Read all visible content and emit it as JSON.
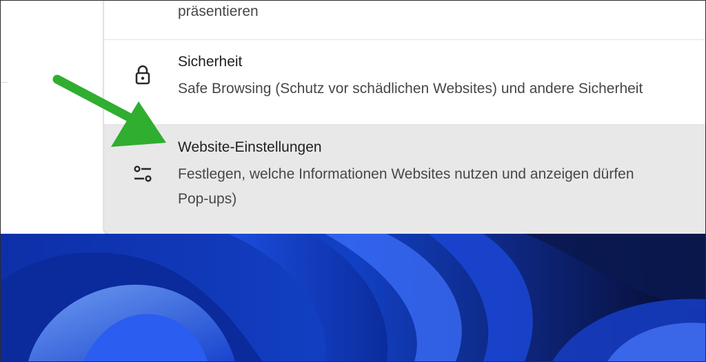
{
  "settings_list": {
    "top_item": {
      "description": "präsentieren"
    },
    "security_item": {
      "title": "Sicherheit",
      "description": "Safe Browsing (Schutz vor schädlichen Websites) und andere Sicherheit",
      "icon": "lock-icon"
    },
    "site_settings_item": {
      "title": "Website-Einstellungen",
      "description_line1": "Festlegen, welche Informationen Websites nutzen und anzeigen dürfen",
      "description_line2": "Pop-ups)",
      "icon": "tune-sliders-icon",
      "highlighted": true
    }
  },
  "annotation": {
    "arrow_color": "#2fae2f",
    "arrow_icon": "arrow-annotation"
  },
  "wallpaper": {
    "style": "windows-11-bloom",
    "colors": [
      "#0a1f6e",
      "#1a4fd6",
      "#5a8cff",
      "#0b0f3a"
    ]
  }
}
